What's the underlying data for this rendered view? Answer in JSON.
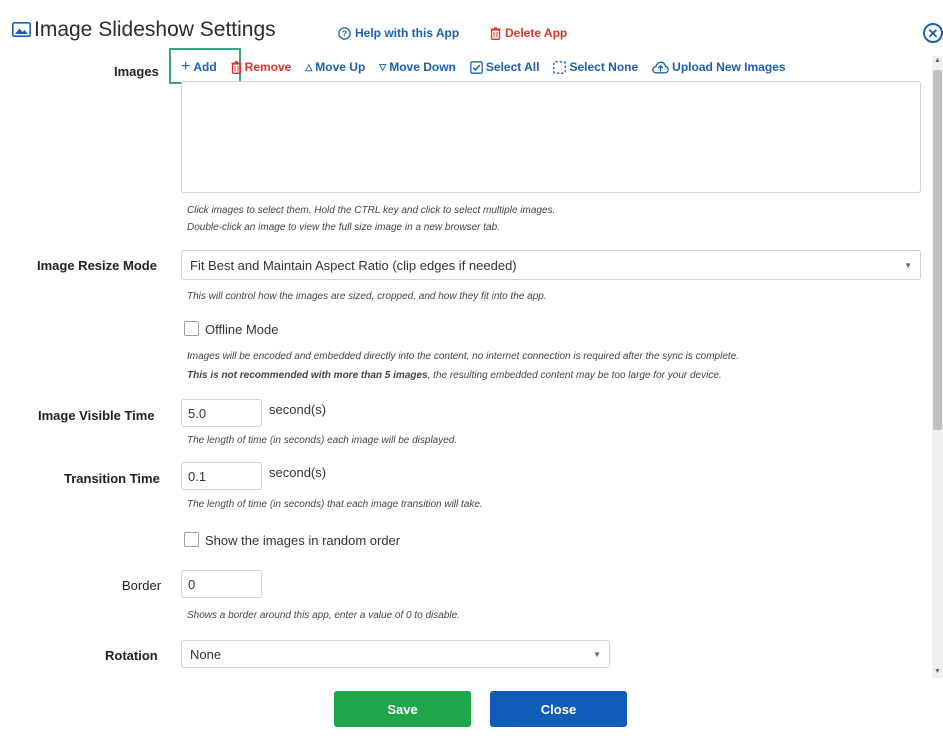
{
  "header": {
    "title": "Image Slideshow Settings",
    "help_label": "Help with this App",
    "delete_label": "Delete App"
  },
  "images": {
    "label": "Images",
    "toolbar": {
      "add": "Add",
      "remove": "Remove",
      "move_up": "Move Up",
      "move_down": "Move Down",
      "select_all": "Select All",
      "select_none": "Select None",
      "upload": "Upload New Images"
    },
    "hint_line1": "Click images to select them. Hold the CTRL key and click to select multiple images.",
    "hint_line2": "Double-click an image to view the full size image in a new browser tab."
  },
  "resize_mode": {
    "label": "Image Resize Mode",
    "value": "Fit Best and Maintain Aspect Ratio (clip edges if needed)",
    "hint": "This will control how the images are sized, cropped, and how they fit into the app."
  },
  "offline": {
    "label": "Offline Mode",
    "checked": false,
    "hint_line1": "Images will be encoded and embedded directly into the content, no internet connection is required after the sync is complete.",
    "hint_bold": "This is not recommended with more than 5 images",
    "hint_rest": ", the resulting embedded content may be too large for your device."
  },
  "visible_time": {
    "label": "Image Visible Time",
    "value": "5.0",
    "unit": "second(s)",
    "hint": "The length of time (in seconds) each image will be displayed."
  },
  "transition_time": {
    "label": "Transition Time",
    "value": "0.1",
    "unit": "second(s)",
    "hint": "The length of time (in seconds) that each image transition will take."
  },
  "random_order": {
    "label": "Show the images in random order",
    "checked": false
  },
  "border": {
    "label": "Border",
    "value": "0",
    "hint": "Shows a border around this app, enter a value of 0 to disable."
  },
  "rotation": {
    "label": "Rotation",
    "value": "None"
  },
  "footer": {
    "save": "Save",
    "close": "Close"
  },
  "colors": {
    "link_blue": "#1a5fb4",
    "danger_red": "#d9342b",
    "save_green": "#1ea64a",
    "close_blue": "#0f5db8",
    "highlight_green": "#3aa57a"
  }
}
